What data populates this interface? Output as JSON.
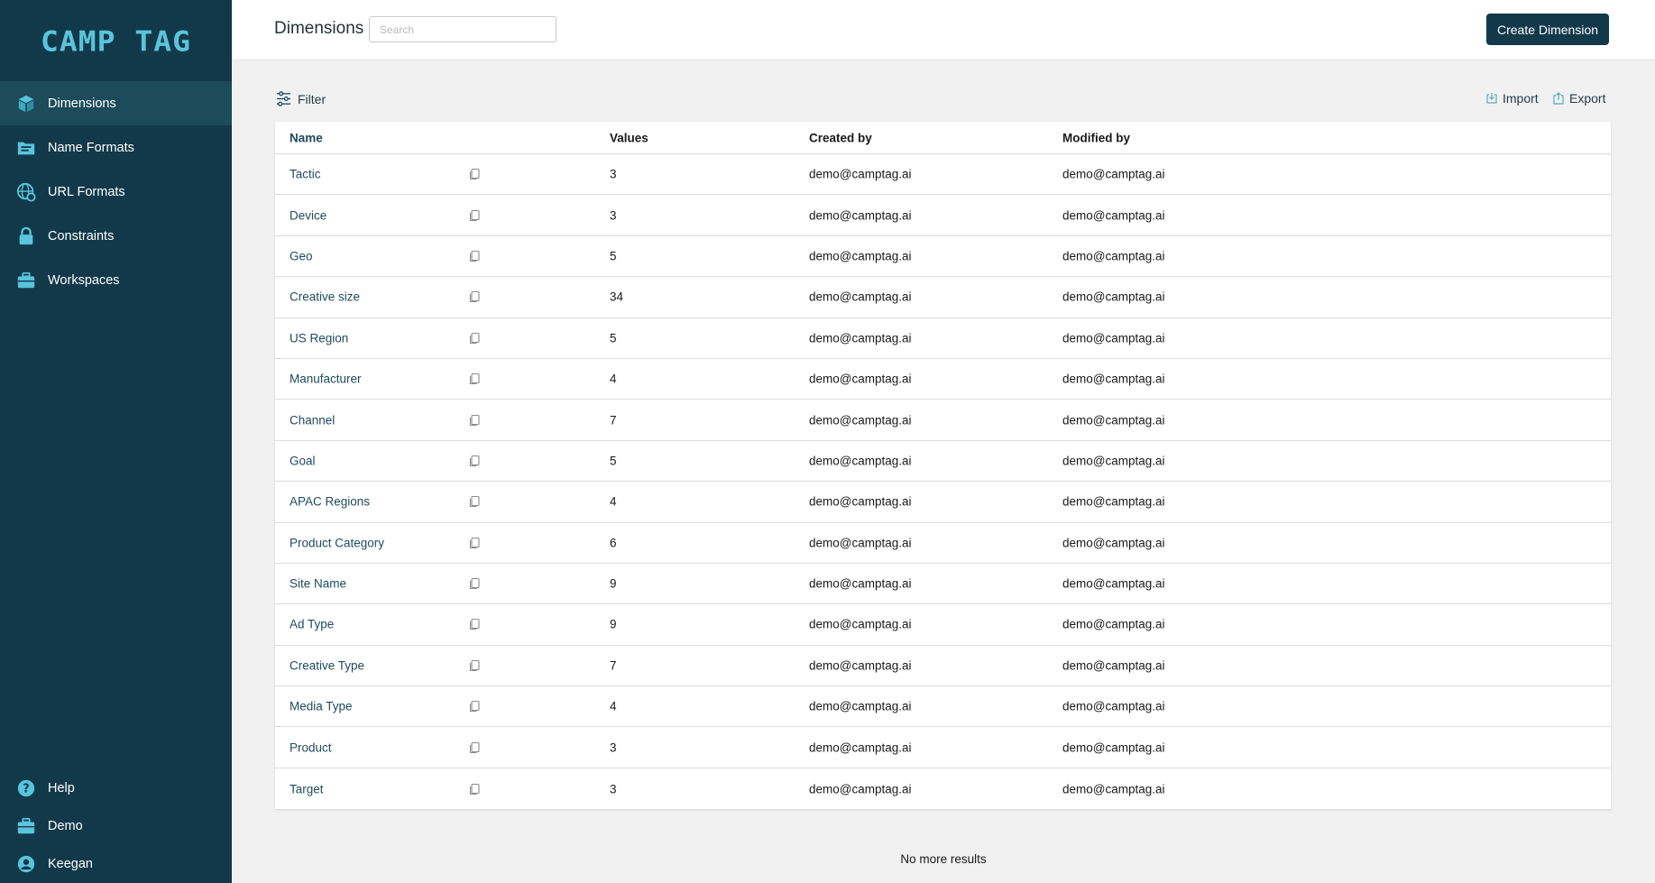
{
  "brand": {
    "logo_text": "CAMP TAG",
    "sidebar_bg": "#12394a",
    "accent": "#59c4da"
  },
  "sidebar": {
    "items": [
      {
        "label": "Dimensions",
        "icon": "cube-icon",
        "active": true
      },
      {
        "label": "Name Formats",
        "icon": "folder-icon"
      },
      {
        "label": "URL Formats",
        "icon": "globe-link-icon"
      },
      {
        "label": "Constraints",
        "icon": "lock-icon"
      },
      {
        "label": "Workspaces",
        "icon": "briefcase-icon"
      }
    ],
    "bottom": [
      {
        "label": "Help",
        "icon": "help-icon"
      },
      {
        "label": "Demo",
        "icon": "briefcase-icon"
      },
      {
        "label": "Keegan",
        "icon": "user-icon"
      }
    ]
  },
  "header": {
    "title": "Dimensions",
    "search_placeholder": "Search",
    "create_button": "Create Dimension"
  },
  "toolbar": {
    "filter": "Filter",
    "import": "Import",
    "export": "Export"
  },
  "table": {
    "columns": [
      "Name",
      "Values",
      "Created by",
      "Modified by"
    ],
    "rows": [
      {
        "name": "Tactic",
        "values": "3",
        "created_by": "demo@camptag.ai",
        "modified_by": "demo@camptag.ai"
      },
      {
        "name": "Device",
        "values": "3",
        "created_by": "demo@camptag.ai",
        "modified_by": "demo@camptag.ai"
      },
      {
        "name": "Geo",
        "values": "5",
        "created_by": "demo@camptag.ai",
        "modified_by": "demo@camptag.ai"
      },
      {
        "name": "Creative size",
        "values": "34",
        "created_by": "demo@camptag.ai",
        "modified_by": "demo@camptag.ai"
      },
      {
        "name": "US Region",
        "values": "5",
        "created_by": "demo@camptag.ai",
        "modified_by": "demo@camptag.ai"
      },
      {
        "name": "Manufacturer",
        "values": "4",
        "created_by": "demo@camptag.ai",
        "modified_by": "demo@camptag.ai"
      },
      {
        "name": "Channel",
        "values": "7",
        "created_by": "demo@camptag.ai",
        "modified_by": "demo@camptag.ai"
      },
      {
        "name": "Goal",
        "values": "5",
        "created_by": "demo@camptag.ai",
        "modified_by": "demo@camptag.ai"
      },
      {
        "name": "APAC Regions",
        "values": "4",
        "created_by": "demo@camptag.ai",
        "modified_by": "demo@camptag.ai"
      },
      {
        "name": "Product Category",
        "values": "6",
        "created_by": "demo@camptag.ai",
        "modified_by": "demo@camptag.ai"
      },
      {
        "name": "Site Name",
        "values": "9",
        "created_by": "demo@camptag.ai",
        "modified_by": "demo@camptag.ai"
      },
      {
        "name": "Ad Type",
        "values": "9",
        "created_by": "demo@camptag.ai",
        "modified_by": "demo@camptag.ai"
      },
      {
        "name": "Creative Type",
        "values": "7",
        "created_by": "demo@camptag.ai",
        "modified_by": "demo@camptag.ai"
      },
      {
        "name": "Media Type",
        "values": "4",
        "created_by": "demo@camptag.ai",
        "modified_by": "demo@camptag.ai"
      },
      {
        "name": "Product",
        "values": "3",
        "created_by": "demo@camptag.ai",
        "modified_by": "demo@camptag.ai"
      },
      {
        "name": "Target",
        "values": "3",
        "created_by": "demo@camptag.ai",
        "modified_by": "demo@camptag.ai"
      }
    ]
  },
  "footer": {
    "status": "No more results"
  }
}
